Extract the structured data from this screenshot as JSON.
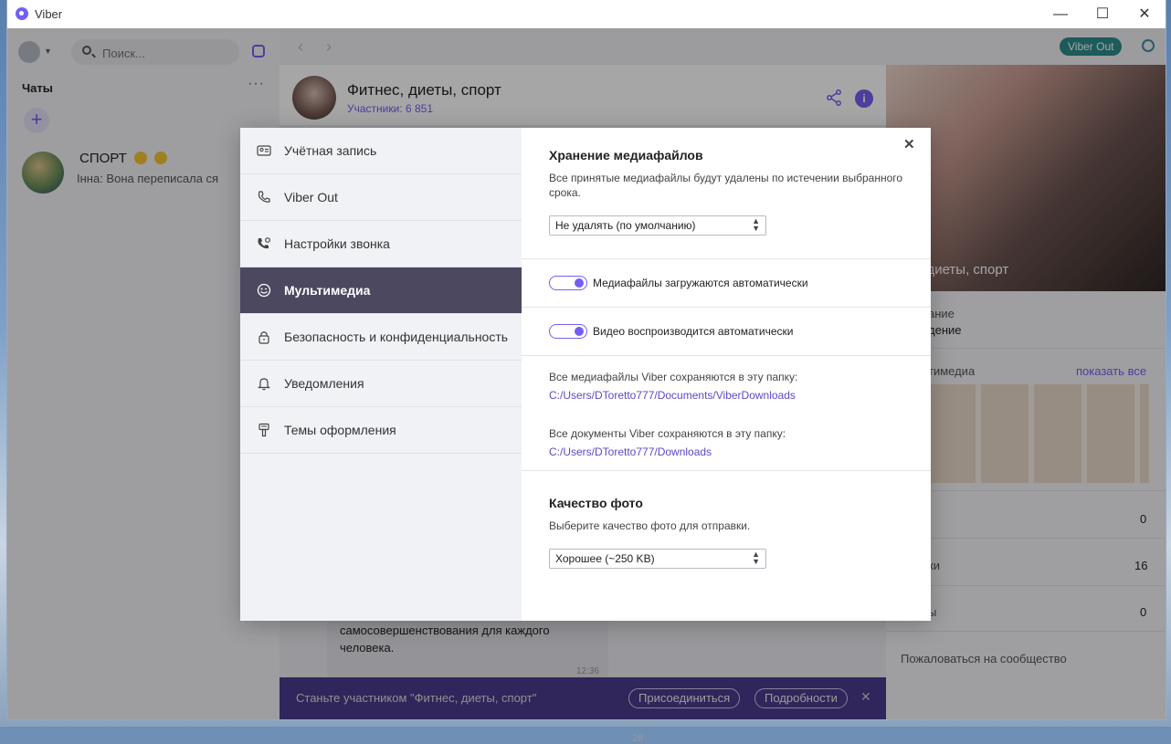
{
  "window": {
    "title": "Viber",
    "minimize": "—",
    "maximize": "☐",
    "close": "✕"
  },
  "sidebar": {
    "search_placeholder": "Поиск...",
    "chats_label": "Чаты",
    "more": "···",
    "add": "+",
    "chat": {
      "name": "СПОРТ",
      "preview": "Інна: Вона переписала ся"
    }
  },
  "main": {
    "nav_back": "‹",
    "nav_forward": "›",
    "viber_out_badge": "Viber Out",
    "group_name": "Фитнес, диеты, спорт",
    "group_members": "Участники: 6 851",
    "message_text": "самосовершенствования для каждого человека.",
    "message_time": "12:36",
    "message_count": "28",
    "join_bar": {
      "text": "Станьте участником \"Фитнес, диеты, спорт\"",
      "join_button": "Присоединиться",
      "details_button": "Подробности",
      "close": "✕"
    }
  },
  "right_panel": {
    "photo_title": "нес, диеты, спорт",
    "label1": "ание",
    "value1": "дение",
    "media_label": "тимедиа",
    "show_all": "показать все",
    "row1_value": "0",
    "row2_label": "ки",
    "row2_value": "16",
    "row3_label": "ы",
    "row3_value": "0",
    "report": "Пожаловаться на сообщество"
  },
  "settings": {
    "nav": [
      {
        "label": "Учётная запись",
        "icon": "account-card-icon"
      },
      {
        "label": "Viber Out",
        "icon": "phone-icon"
      },
      {
        "label": "Настройки звонка",
        "icon": "call-settings-icon"
      },
      {
        "label": "Мультимедиа",
        "icon": "media-smiley-icon",
        "active": true
      },
      {
        "label": "Безопасность и конфиденциальность",
        "icon": "lock-icon"
      },
      {
        "label": "Уведомления",
        "icon": "bell-icon"
      },
      {
        "label": "Темы оформления",
        "icon": "paint-brush-icon"
      }
    ],
    "close": "✕",
    "media_storage": {
      "title": "Хранение медиафайлов",
      "description": "Все принятые медиафайлы будут удалены по истечении выбранного срока.",
      "selected": "Не удалять (по умолчанию)"
    },
    "auto_download_label": "Медиафайлы загружаются автоматически",
    "auto_download_on": true,
    "autoplay_label": "Видео воспроизводится автоматически",
    "autoplay_on": true,
    "media_folder_label": "Все медиафайлы Viber сохраняются в эту папку:",
    "media_folder_path": "C:/Users/DToretto777/Documents/ViberDownloads",
    "docs_folder_label": "Все документы Viber сохраняются в эту папку:",
    "docs_folder_path": "C:/Users/DToretto777/Downloads",
    "photo_quality": {
      "title": "Качество фото",
      "description": "Выберите качество фото для отправки.",
      "selected": "Хорошее (~250 KB)"
    }
  },
  "colors": {
    "accent": "#7360f2",
    "active_nav_bg": "#4c4860",
    "join_bar_bg": "#4b3b8c",
    "viber_out_badge": "#2d8c8c"
  }
}
